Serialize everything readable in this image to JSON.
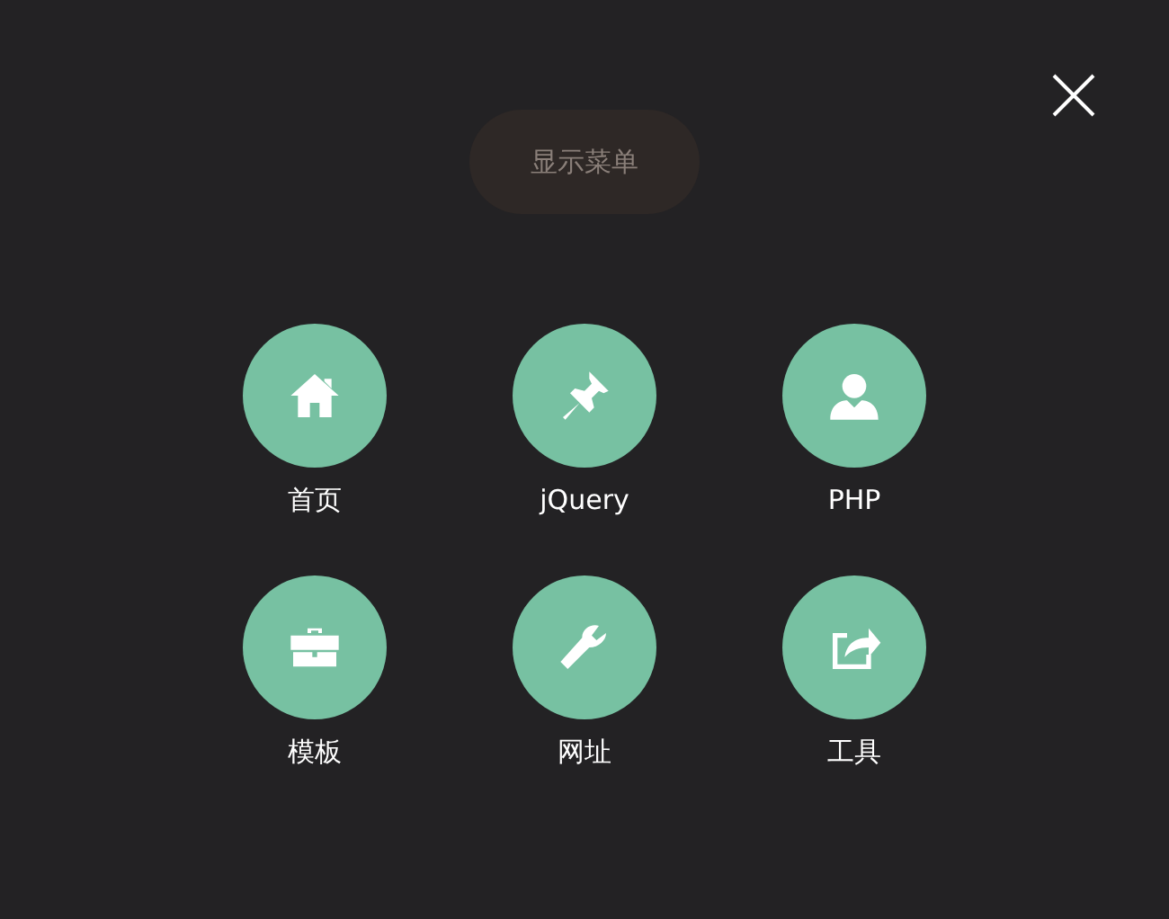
{
  "menu_button": {
    "label": "显示菜单"
  },
  "items": [
    {
      "label": "首页",
      "kind": "home"
    },
    {
      "label": "jQuery",
      "kind": "pin"
    },
    {
      "label": "PHP",
      "kind": "person"
    },
    {
      "label": "模板",
      "kind": "briefcase"
    },
    {
      "label": "网址",
      "kind": "wrench"
    },
    {
      "label": "工具",
      "kind": "share"
    }
  ]
}
